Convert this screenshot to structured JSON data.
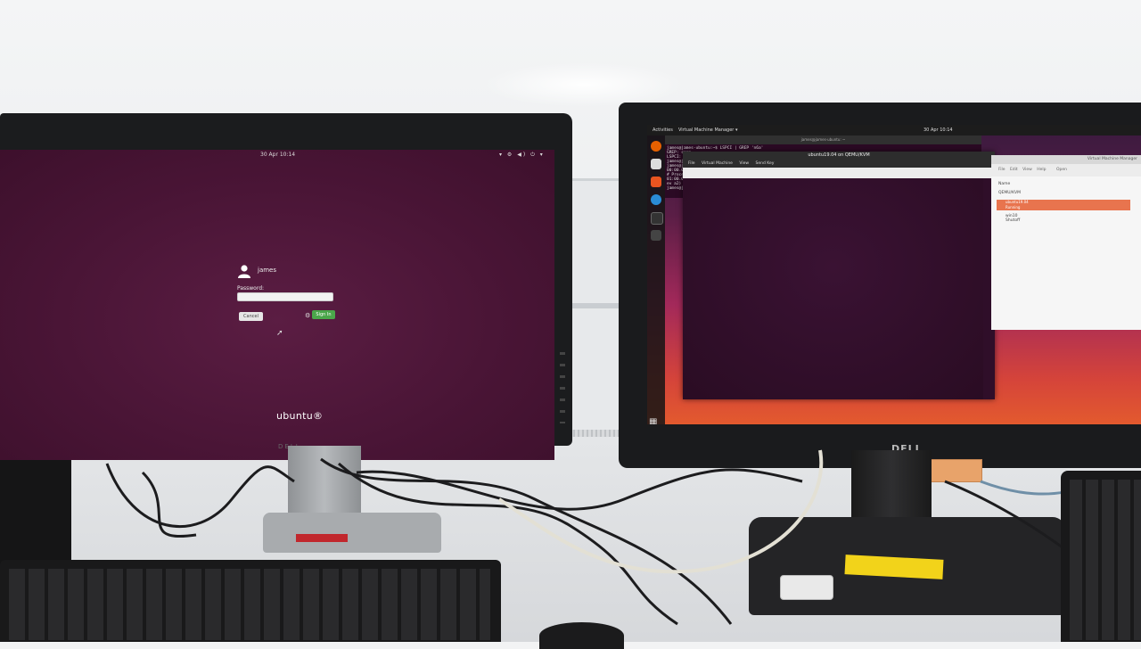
{
  "left_screen": {
    "date_time": "30 Apr 10:14",
    "tray_icons": "▾ ⚙ ◀) ⏻ ▾",
    "login": {
      "username": "james",
      "password_label": "Password:",
      "cancel_label": "Cancel",
      "signin_label": "Sign In"
    },
    "logo_text": "ubuntu®",
    "monitor_brand": "DELL"
  },
  "right_screen": {
    "topbar": {
      "activities": "Activities",
      "app_menu": "Virtual Machine Manager ▾",
      "date_time": "30 Apr 10:14"
    },
    "terminal": {
      "title": "james@james-ubuntu: ~",
      "lines": [
        "james@james-ubuntu:~$ LSPCI | GREP 'n6a'",
        "GREP: conm",
        "LSPCI: con",
        "james@jame",
        "james@jame",
        "00:00.0 H",
        "# Process",
        "01:00.0 V",
        "ev a2)",
        "james@jame"
      ]
    },
    "vm_window": {
      "title": "ubuntu19.04 on QEMU/KVM",
      "menu": [
        "File",
        "Virtual Machine",
        "View",
        "Send Key"
      ]
    },
    "manager": {
      "title": "Virtual Machine Manager",
      "menu": [
        "File",
        "Edit",
        "View",
        "Help"
      ],
      "open_label": "Open",
      "column_name": "Name",
      "group": "QEMU/KVM",
      "vms": [
        {
          "name": "ubuntu19.04",
          "status": "Running",
          "selected": true
        },
        {
          "name": "win10",
          "status": "Shutoff",
          "selected": false
        }
      ]
    },
    "monitor_brand": "DELL"
  },
  "colors": {
    "ubuntu_login_bg": "#4a1536",
    "signin_green": "#4aa64a",
    "selection_orange": "#e8744e",
    "sticker_yellow": "#f2d31a"
  }
}
